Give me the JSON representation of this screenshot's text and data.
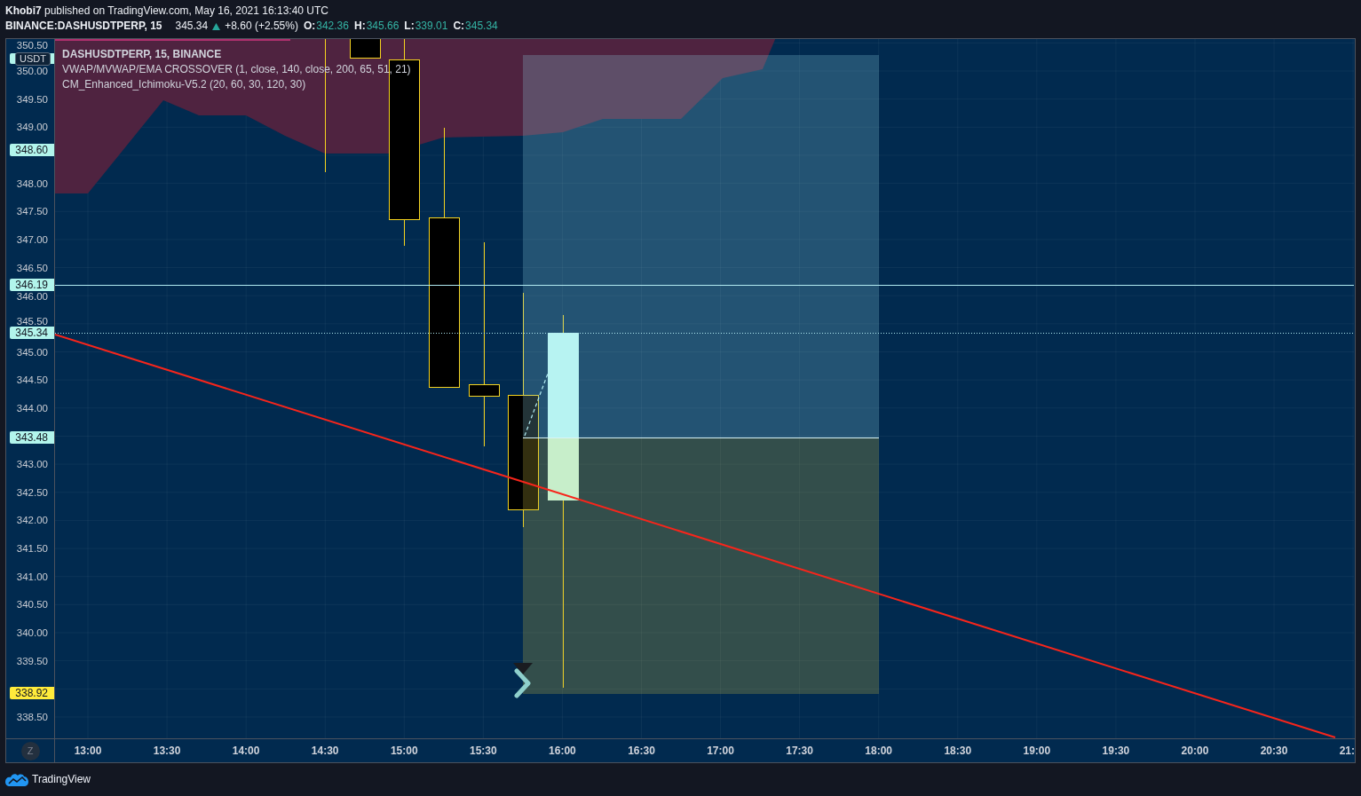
{
  "header": {
    "publication": "**Khobi7** published on TradingView.com, May 16, 2021 16:13:40 UTC",
    "symbol": "BINANCE:DASHUSDTPERP, 15",
    "last_price": "345.34",
    "rising": true,
    "change": "+8.60 (+2.55%)",
    "ohlc": [
      {
        "label": "O:",
        "value": "342.36"
      },
      {
        "label": "H:",
        "value": "345.66"
      },
      {
        "label": "L:",
        "value": "339.01"
      },
      {
        "label": "C:",
        "value": "345.34"
      }
    ]
  },
  "legend": {
    "title": "DASHUSDTPERP, 15, BINANCE",
    "indicators": [
      "VWAP/MVWAP/EMA CROSSOVER (1, close, 140, close, 200, 65, 51, 21)",
      "CM_Enhanced_Ichimoku-V5.2 (20, 60, 30, 120, 30)"
    ]
  },
  "price_axis": {
    "currency": "USDT",
    "ticks": [
      "350.50",
      "350.00",
      "349.50",
      "349.00",
      "348.00",
      "347.50",
      "347.00",
      "346.50",
      "346.00",
      "345.50",
      "345.00",
      "344.50",
      "344.00",
      "343.00",
      "342.50",
      "342.00",
      "341.50",
      "341.00",
      "340.50",
      "340.00",
      "339.50",
      "338.50"
    ],
    "tags": [
      {
        "text": "348.60",
        "color": "#b2f5ec"
      },
      {
        "text": "346.19",
        "color": "#b2f5ec"
      },
      {
        "text": "345.34",
        "color": "#b2f5ec"
      },
      {
        "text": "343.48",
        "color": "#b2f5ec"
      },
      {
        "text": "338.92",
        "color": "#ffeb3b"
      }
    ]
  },
  "time_axis": {
    "scale_button": "Z",
    "ticks": [
      "13:00",
      "13:30",
      "14:00",
      "14:30",
      "15:00",
      "15:30",
      "16:00",
      "16:30",
      "17:00",
      "17:30",
      "18:00",
      "18:30",
      "19:00",
      "19:30",
      "20:00",
      "20:30",
      "21:"
    ]
  },
  "footer": {
    "brand": "TradingView"
  }
}
